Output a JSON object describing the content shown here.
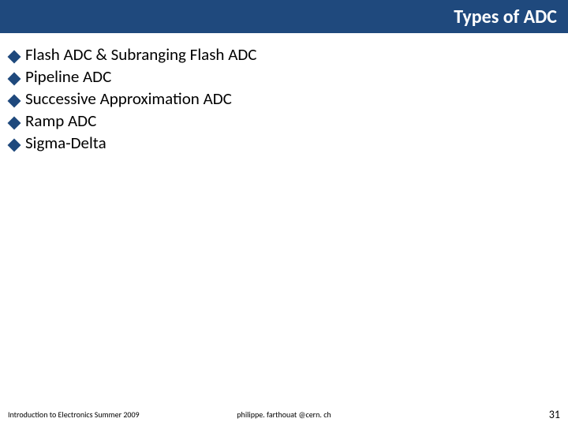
{
  "header": {
    "title": "Types of ADC"
  },
  "bullets": [
    {
      "text": "Flash ADC & Subranging Flash ADC"
    },
    {
      "text": "Pipeline ADC"
    },
    {
      "text": "Successive Approximation ADC"
    },
    {
      "text": "Ramp ADC"
    },
    {
      "text": "Sigma-Delta"
    }
  ],
  "footer": {
    "left": "Introduction to Electronics Summer 2009",
    "center": "philippe. farthouat @cern. ch",
    "right": "31"
  }
}
